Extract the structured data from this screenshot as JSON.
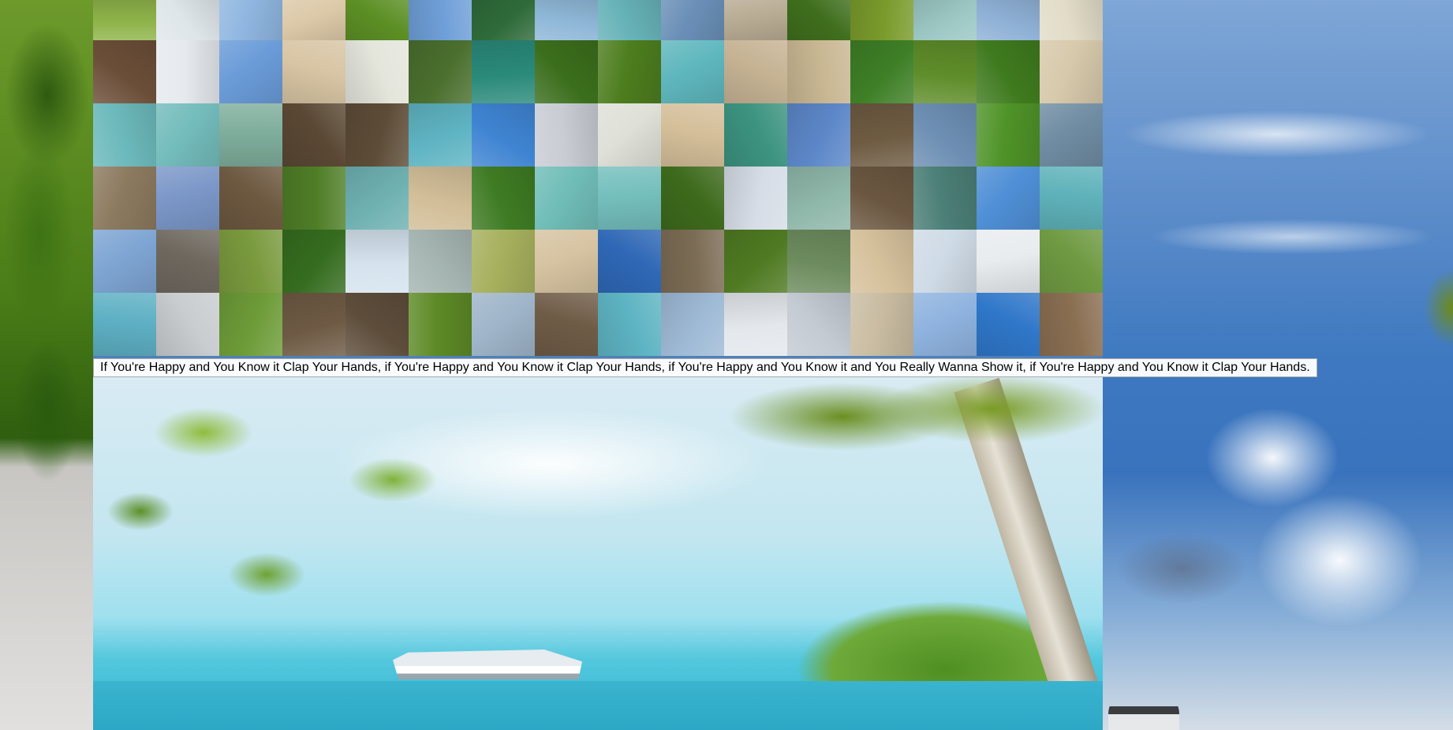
{
  "caption": "If You're Happy and You Know it Clap Your Hands, if You're Happy and You Know it Clap Your Hands, if You're Happy and You Know it and You Really Wanna Show it, if You're Happy and You Know it Clap Your Hands.",
  "tiles": [
    [
      "#8fb44a",
      "#dfe6ea",
      "#8fb6e0",
      "#dcc9a8",
      "#5c8f25",
      "#6f9fd8",
      "#2f6b3a",
      "#8fb8d8",
      "#66b2b7",
      "#6a8fb7",
      "#b8ab93",
      "#3f6e1d",
      "#7a9b2c",
      "#9cc8c4",
      "#8fb1d6",
      "#e2dcc8"
    ],
    [
      "#6b4e38",
      "#e6eaee",
      "#6a9bd8",
      "#d8c5a4",
      "#e4e6dc",
      "#4a6f2e",
      "#2a8a7a",
      "#3b6e1c",
      "#4d7d1e",
      "#5eb7bd",
      "#c6b394",
      "#c9b793",
      "#3e7f26",
      "#5f8d2a",
      "#3f7a1e",
      "#d7c9ab"
    ],
    [
      "#6cb9bb",
      "#74bcbc",
      "#7fae9d",
      "#5a4834",
      "#5d4c37",
      "#5fb4c3",
      "#3f84d2",
      "#c9ccd3",
      "#dfe0d8",
      "#d5bf9a",
      "#3c9380",
      "#5c87c8",
      "#6e5b42",
      "#6d8fb3",
      "#4f9328",
      "#6f8ca2"
    ],
    [
      "#8c7a5f",
      "#7b97c8",
      "#6d5840",
      "#4f7e27",
      "#6fb1b2",
      "#d2be98",
      "#3e7b23",
      "#70bdb8",
      "#74bfbd",
      "#3d6a1c",
      "#d6dde6",
      "#8fb7aa",
      "#6b5741",
      "#4b7f77",
      "#4f8fd6",
      "#5fb2ba"
    ],
    [
      "#7ea5d3",
      "#6e685f",
      "#7a9a3e",
      "#356c1f",
      "#d5e3ee",
      "#a5b5b2",
      "#a6b05d",
      "#d6c3a1",
      "#2f68b6",
      "#7c6c55",
      "#4f7a22",
      "#6d8c5e",
      "#d6c19c",
      "#cfdbe6",
      "#e9ecef",
      "#6f9a42"
    ],
    [
      "#5eb0c4",
      "#c9cdd0",
      "#6e9c39",
      "#6e5a44",
      "#5e4d3b",
      "#5d8a26",
      "#9fb5c9",
      "#6f5c47",
      "#5eb4c3",
      "#9fbad6",
      "#e4e8ec",
      "#c5cbd3",
      "#c9bca2",
      "#8fb3df",
      "#2f77c9",
      "#8a6f52"
    ]
  ]
}
